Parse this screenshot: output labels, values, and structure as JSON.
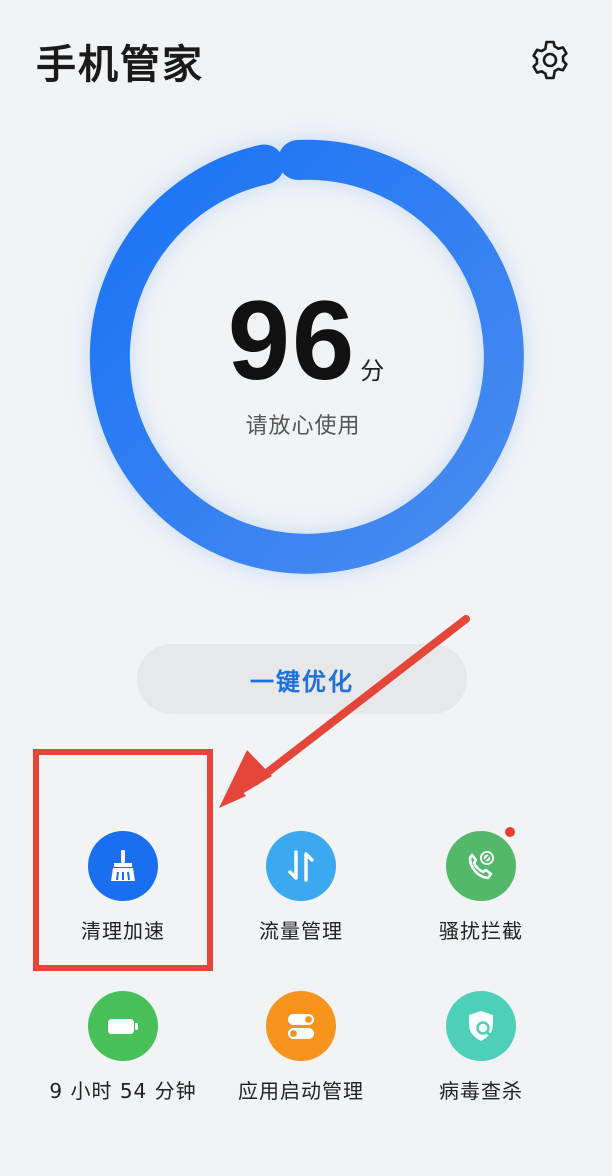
{
  "app": {
    "title": "手机管家"
  },
  "score": {
    "value": "96",
    "unit": "分",
    "status": "请放心使用"
  },
  "optimize": {
    "label": "一键优化"
  },
  "tools": [
    {
      "label": "清理加速",
      "icon": "broom-icon",
      "color": "#1a6ff0"
    },
    {
      "label": "流量管理",
      "icon": "data-transfer-icon",
      "color": "#3aa9f2"
    },
    {
      "label": "骚扰拦截",
      "icon": "phone-block-icon",
      "color": "#53b86a"
    },
    {
      "label": "9 小时 54 分钟",
      "icon": "battery-icon",
      "color": "#48c05a"
    },
    {
      "label": "应用启动管理",
      "icon": "toggle-icon",
      "color": "#f7941e"
    },
    {
      "label": "病毒查杀",
      "icon": "shield-search-icon",
      "color": "#4ecfb8"
    }
  ],
  "colors": {
    "accent": "#1f6fdd",
    "ring_start": "#1a73f5",
    "ring_end": "#4b8cf0",
    "highlight": "#e4463a"
  }
}
